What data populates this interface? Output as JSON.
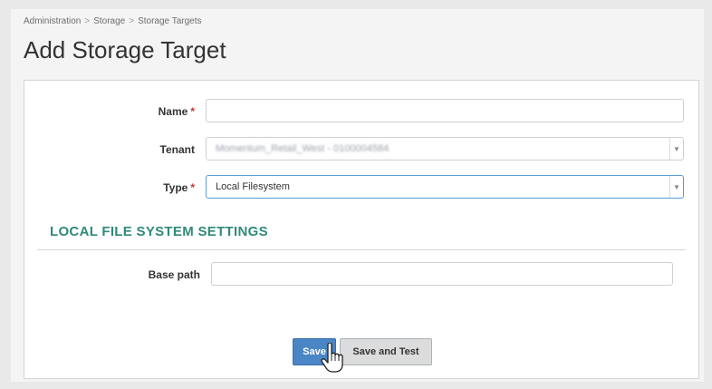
{
  "breadcrumb": {
    "items": [
      "Administration",
      "Storage",
      "Storage Targets"
    ],
    "separator": ">"
  },
  "page_title": "Add Storage Target",
  "form": {
    "name": {
      "label": "Name",
      "required_marker": "*",
      "value": ""
    },
    "tenant": {
      "label": "Tenant",
      "value": "Momentum_Retail_West - 0100004584"
    },
    "type": {
      "label": "Type",
      "required_marker": "*",
      "value": "Local Filesystem"
    }
  },
  "section": {
    "title": "LOCAL FILE SYSTEM SETTINGS",
    "base_path": {
      "label": "Base path",
      "value": ""
    }
  },
  "buttons": {
    "save": "Save",
    "save_and_test": "Save and Test"
  },
  "icons": {
    "dropdown": "chevron-down-icon",
    "cursor": "hand-pointer-icon"
  },
  "colors": {
    "section_title": "#2f8a7a",
    "required": "#d0312d",
    "primary_button": "#4a86c5",
    "secondary_button": "#dcdcdc"
  }
}
